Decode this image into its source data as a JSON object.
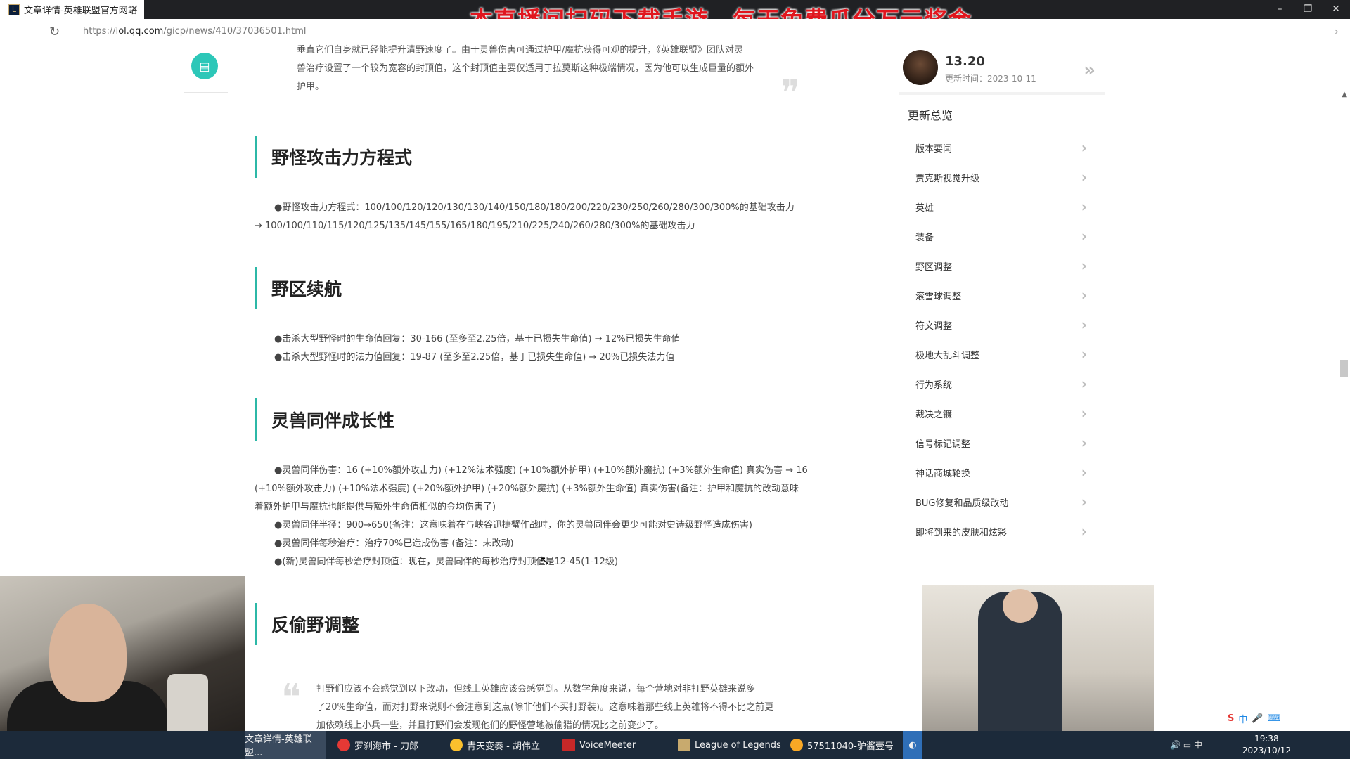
{
  "browser": {
    "tab_title": "文章详情-英雄联盟官方网站",
    "tab_icon": "L",
    "url_prefix": "https://",
    "url_host": "lol.qq.com",
    "url_path": "/gicp/news/410/37036501.html",
    "stream_banner": "本直播间扫码下载手游，每天免费瓜分万元奖金"
  },
  "article": {
    "intro_line1": "垂直它们自身就已经能提升清野速度了。由于灵兽伤害可通过护甲/魔抗获得可观的提升，《英雄联盟》团队对灵",
    "intro_line2": "兽治疗设置了一个较为宽容的封顶值，这个封顶值主要仅适用于拉莫斯这种极端情况，因为他可以生成巨量的额外",
    "intro_line3": "护甲。",
    "quote_mark": "❞",
    "sections": [
      {
        "title": "野怪攻击力方程式",
        "lines": [
          "●野怪攻击力方程式：100/100/120/120/130/130/140/150/180/180/200/220/230/250/260/280/300/300%的基础攻击力",
          "→ 100/100/110/115/120/125/135/145/155/165/180/195/210/225/240/260/280/300%的基础攻击力"
        ]
      },
      {
        "title": "野区续航",
        "lines": [
          "●击杀大型野怪时的生命值回复：30-166 (至多至2.25倍，基于已损失生命值) → 12%已损失生命值",
          "●击杀大型野怪时的法力值回复：19-87 (至多至2.25倍，基于已损失生命值) → 20%已损失法力值"
        ]
      },
      {
        "title": "灵兽同伴成长性",
        "lines": [
          "●灵兽同伴伤害：16 (+10%额外攻击力) (+12%法术强度) (+10%额外护甲) (+10%额外魔抗) (+3%额外生命值) 真实伤害 → 16",
          "(+10%额外攻击力) (+10%法术强度) (+20%额外护甲) (+20%额外魔抗) (+3%额外生命值) 真实伤害(备注：护甲和魔抗的改动意味",
          "着额外护甲与魔抗也能提供与额外生命值相似的金均伤害了)",
          "●灵兽同伴半径：900→650(备注：这意味着在与峡谷迅捷蟹作战时，你的灵兽同伴会更少可能对史诗级野怪造成伤害)",
          "●灵兽同伴每秒治疗：治疗70%已造成伤害 (备注：未改动)",
          "●(新)灵兽同伴每秒治疗封顶值：现在，灵兽同伴的每秒治疗封顶值是12-45(1-12级)"
        ]
      },
      {
        "title": "反偷野调整",
        "lines": []
      }
    ],
    "quote2_mark": "❝",
    "quote2_lines": [
      "打野们应该不会感觉到以下改动，但线上英雄应该会感觉到。从数学角度来说，每个营地对非打野英雄来说多",
      "了20%生命值，而对打野来说则不会注意到这点(除非他们不买打野装)。这意味着那些线上英雄将不得不比之前更",
      "加依赖线上小兵一些，并且打野们会发现他们的野怪营地被偷猎的情况比之前变少了。"
    ]
  },
  "sidebar": {
    "version": "13.20",
    "update_date": "更新时间：2023-10-11",
    "more_icon": "»",
    "summary_title": "更新总览",
    "items": [
      {
        "label": "版本要闻"
      },
      {
        "label": "贾克斯视觉升级"
      },
      {
        "label": "英雄"
      },
      {
        "label": "装备"
      },
      {
        "label": "野区调整"
      },
      {
        "label": "滚雪球调整"
      },
      {
        "label": "符文调整"
      },
      {
        "label": "极地大乱斗调整"
      },
      {
        "label": "行为系统"
      },
      {
        "label": "裁决之镰"
      },
      {
        "label": "信号标记调整"
      },
      {
        "label": "神话商城轮换"
      },
      {
        "label": "BUG修复和品质级改动"
      },
      {
        "label": "即将到来的皮肤和炫彩"
      }
    ]
  },
  "taskbar": {
    "items": [
      {
        "label": "文章详情-英雄联盟...",
        "color": "#3a4a5e"
      },
      {
        "label": "罗刹海市 - 刀郎",
        "color": "#e53935"
      },
      {
        "label": "青天变奏 - 胡伟立",
        "color": "#fbc02d"
      },
      {
        "label": "VoiceMeeter",
        "color": "#c62828"
      },
      {
        "label": "League of Legends",
        "color": "#c8aa6e"
      },
      {
        "label": "57511040-驴酱壹号",
        "color": "#f9a825"
      }
    ],
    "time": "19:38",
    "date": "2023/10/12",
    "ime_label": "中"
  }
}
